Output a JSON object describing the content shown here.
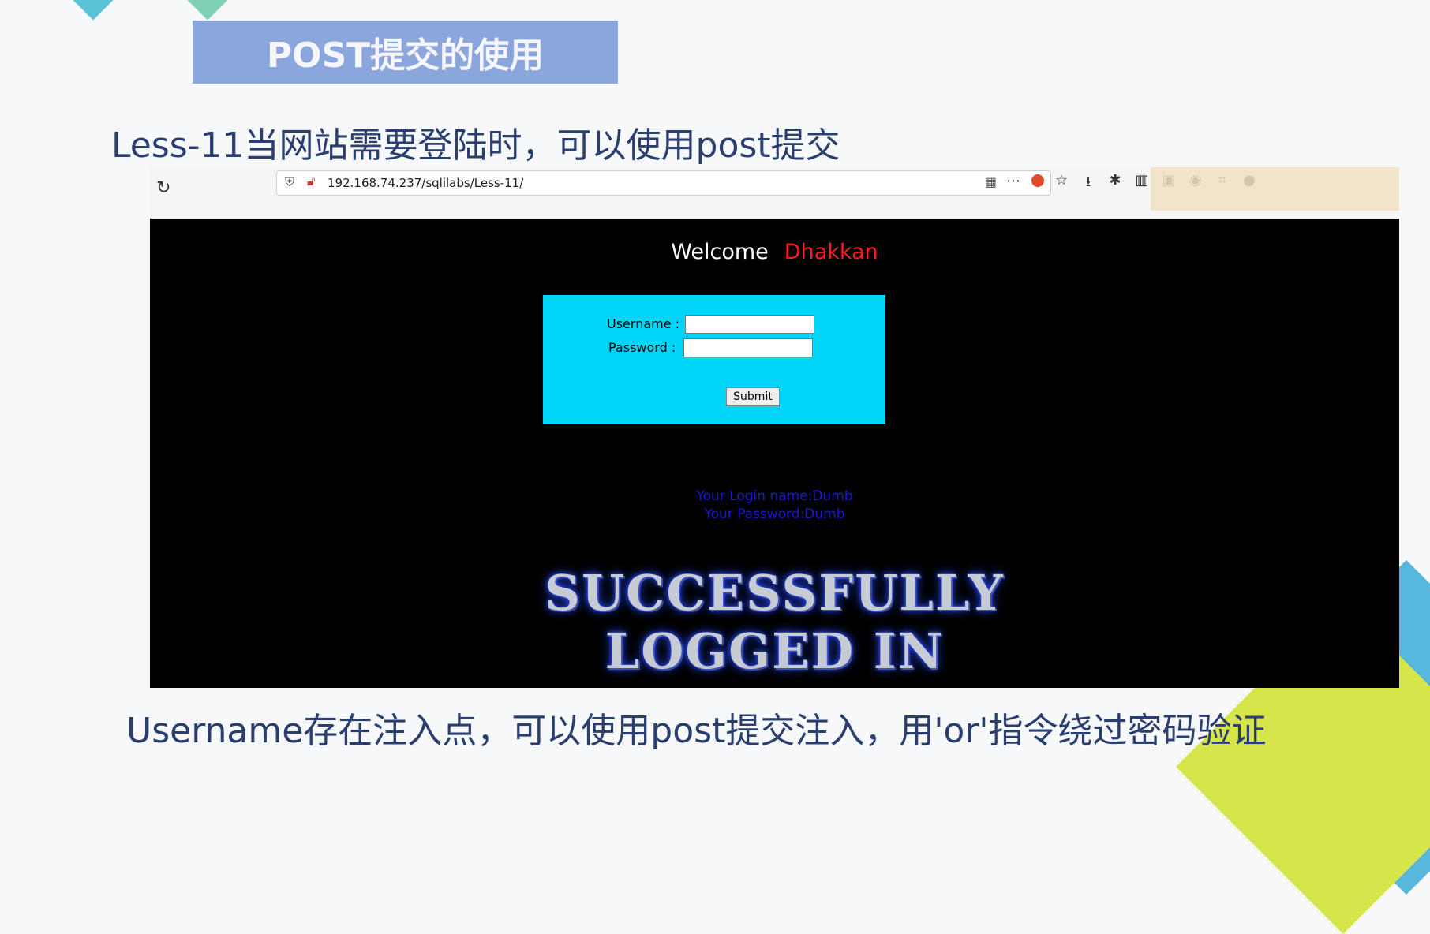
{
  "slide": {
    "banner": "POST提交的使用",
    "subtitle": "Less-11当网站需要登陆时，可以使用post提交",
    "footer": "Username存在注入点，可以使用post提交注入，用'or'指令绕过密码验证"
  },
  "browser": {
    "url": "192.168.74.237/sqlilabs/Less-11/",
    "toolbar_icons": [
      "download-icon",
      "extensions-icon",
      "library-icon",
      "sidebar-icon",
      "account-icon",
      "crop-icon",
      "chat-icon"
    ]
  },
  "page": {
    "welcome": "Welcome",
    "name": "Dhakkan",
    "form": {
      "username_label": "Username :",
      "password_label": "Password :",
      "username_value": "",
      "password_value": "",
      "submit_label": "Submit"
    },
    "login_name": "Your Login name:Dumb",
    "login_password": "Your Password:Dumb",
    "success_line1": "SUCCESSFULLY",
    "success_line2": "LOGGED IN"
  },
  "colors": {
    "login_box": "#00d5f9",
    "welcome_name": "#ff1a1a",
    "result_text": "#1a1ad0",
    "banner": "#8aa6dc"
  }
}
